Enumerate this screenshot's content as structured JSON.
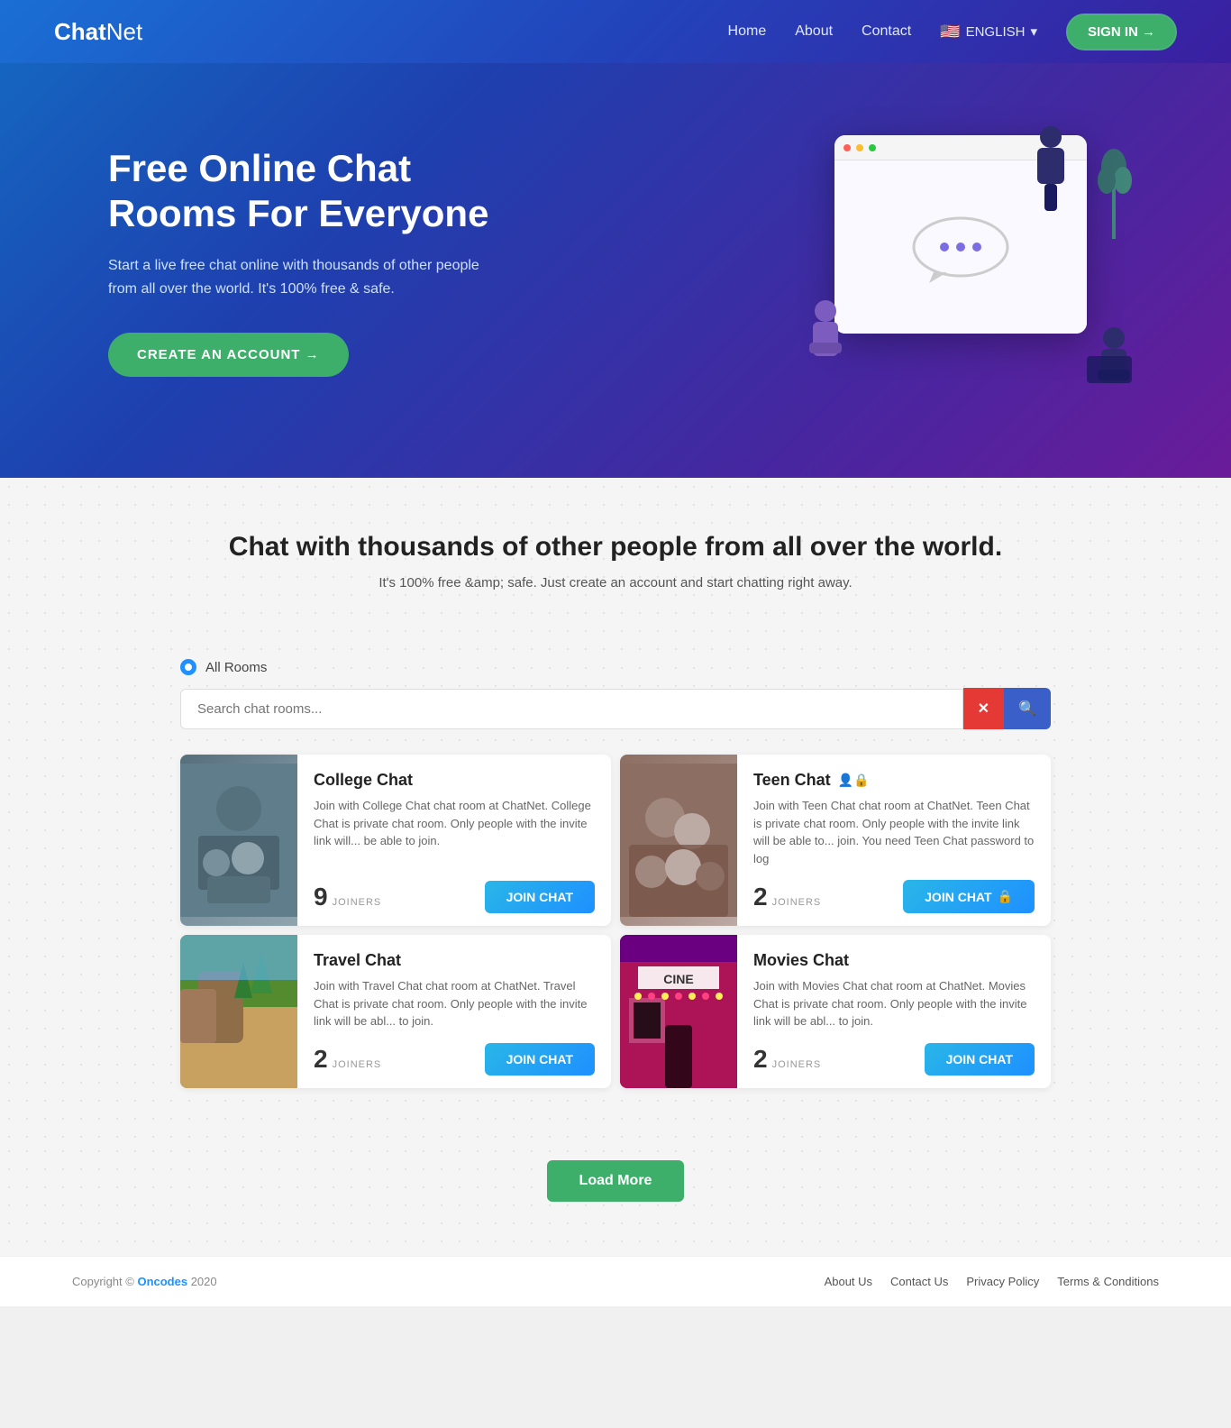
{
  "site": {
    "logo_chat": "Chat",
    "logo_net": "Net"
  },
  "navbar": {
    "links": [
      {
        "label": "Home",
        "id": "home"
      },
      {
        "label": "About",
        "id": "about"
      },
      {
        "label": "Contact",
        "id": "contact"
      }
    ],
    "lang": "ENGLISH",
    "signin_label": "SIGN IN →"
  },
  "hero": {
    "title": "Free Online Chat Rooms For Everyone",
    "subtitle": "Start a live free chat online with thousands of other people from all over the world. It's 100% free & safe.",
    "cta_label": "CREATE AN ACCOUNT →"
  },
  "section_intro": {
    "title": "Chat with thousands of other people from all over the world.",
    "subtitle": "It's 100% free &amp; safe. Just create an account and start chatting right away."
  },
  "rooms": {
    "header_label": "All Rooms",
    "search_placeholder": "Search chat rooms...",
    "cards": [
      {
        "id": "college",
        "title": "College Chat",
        "private": false,
        "desc": "Join with College Chat chat room at ChatNet. College Chat is private chat room. Only people with the invite link will... be able to join.",
        "joiners": "9",
        "joiners_label": "JOINERS",
        "btn_label": "JOIN CHAT",
        "locked": false
      },
      {
        "id": "teen",
        "title": "Teen Chat",
        "private": true,
        "desc": "Join with Teen Chat chat room at ChatNet. Teen Chat is private chat room. Only people with the invite link will be able to... join. You need Teen Chat password to log",
        "joiners": "2",
        "joiners_label": "JOINERS",
        "btn_label": "JOIN CHAT",
        "locked": true
      },
      {
        "id": "travel",
        "title": "Travel Chat",
        "private": false,
        "desc": "Join with Travel Chat chat room at ChatNet. Travel Chat is private chat room. Only people with the invite link will be abl... to join.",
        "joiners": "2",
        "joiners_label": "JOINERS",
        "btn_label": "JOIN CHAT",
        "locked": false
      },
      {
        "id": "movies",
        "title": "Movies Chat",
        "private": false,
        "desc": "Join with Movies Chat chat room at ChatNet. Movies Chat is private chat room. Only people with the invite link will be abl... to join.",
        "joiners": "2",
        "joiners_label": "JOINERS",
        "btn_label": "JOIN CHAT",
        "locked": false
      }
    ]
  },
  "load_more": {
    "label": "Load More"
  },
  "footer": {
    "copy": "Copyright © Oncodes 2020",
    "links": [
      {
        "label": "About Us"
      },
      {
        "label": "Contact Us"
      },
      {
        "label": "Privacy Policy"
      },
      {
        "label": "Terms & Conditions"
      }
    ]
  }
}
